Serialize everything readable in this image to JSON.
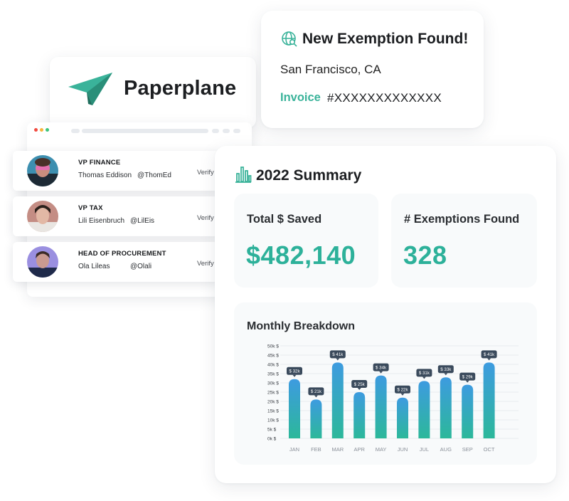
{
  "brand": {
    "name": "Paperplane",
    "logo_icon": "paper-plane-icon",
    "accent": "#3ab39a"
  },
  "browser": {
    "dots": [
      "#f14a40",
      "#f6b53b",
      "#3cc47a"
    ]
  },
  "people": [
    {
      "role": "VP FINANCE",
      "name": "Thomas Eddison",
      "handle": "@ThomEd",
      "action": "Verify"
    },
    {
      "role": "VP TAX",
      "name": "Lili Eisenbruch",
      "handle": "@LilEis",
      "action": "Verify"
    },
    {
      "role": "HEAD OF PROCUREMENT",
      "name": "Ola Lileas",
      "handle": "@Olali",
      "action": "Verify"
    }
  ],
  "notification": {
    "icon": "globe-search-icon",
    "title": "New Exemption Found!",
    "location": "San Francisco, CA",
    "invoice_label": "Invoice",
    "invoice_number": "#XXXXXXXXXXXXX"
  },
  "summary": {
    "icon": "bar-chart-icon",
    "title": "2022 Summary",
    "saved_label": "Total $ Saved",
    "saved_value": "$482,140",
    "exemptions_label": "# Exemptions Found",
    "exemptions_value": "328",
    "breakdown_title": "Monthly Breakdown"
  },
  "chart_data": {
    "type": "bar",
    "title": "Monthly Breakdown",
    "categories": [
      "JAN",
      "FEB",
      "MAR",
      "APR",
      "MAY",
      "JUN",
      "JUL",
      "AUG",
      "SEP",
      "OCT"
    ],
    "values": [
      32,
      21,
      41,
      25,
      34,
      22,
      31,
      33,
      29,
      41
    ],
    "data_labels": [
      "$ 32k",
      "$ 21k",
      "$ 41k",
      "$ 25k",
      "$ 34k",
      "$ 22k",
      "$ 31k",
      "$ 33k",
      "$ 29k",
      "$ 41k"
    ],
    "y_ticks": [
      "50k $",
      "45k $",
      "40k $",
      "35k $",
      "30k $",
      "25k $",
      "20k $",
      "15k $",
      "10k $",
      "5k $",
      "0k $"
    ],
    "ylim": [
      0,
      50
    ],
    "grid": true,
    "bar_gradient": [
      "#3d9be0",
      "#2cb89a"
    ],
    "label_bg": "#3a4a5c"
  }
}
